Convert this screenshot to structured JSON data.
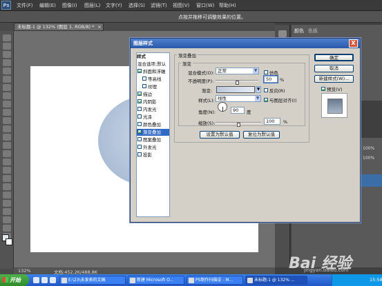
{
  "app": {
    "logo": "Ps"
  },
  "menu": [
    "文件(F)",
    "编辑(E)",
    "图像(I)",
    "图层(L)",
    "文字(Y)",
    "选择(S)",
    "滤镜(T)",
    "视图(V)",
    "窗口(W)",
    "帮助(H)"
  ],
  "options_bar": {
    "hint": "点按并拖移可调整效果的位置。"
  },
  "document": {
    "tab_title": "未标题-1 @ 132% (图层 1, RGB/8) *",
    "close": "×",
    "zoom": "132%",
    "doc_info": "文档:452.2K/488.8K"
  },
  "panels": {
    "color_tab": "颜色",
    "swatches_tab": "色板",
    "percent_a": "100%",
    "percent_b": "100%"
  },
  "dialog": {
    "title": "图层样式",
    "close": "X",
    "styles_header": "样式",
    "style_items": [
      {
        "label": "混合选项:默认",
        "checkbox": false,
        "checked": false,
        "selected": false
      },
      {
        "label": "斜面和浮雕",
        "checkbox": true,
        "checked": true,
        "selected": false
      },
      {
        "label": "等高线",
        "checkbox": true,
        "checked": false,
        "selected": false
      },
      {
        "label": "纹理",
        "checkbox": true,
        "checked": false,
        "selected": false
      },
      {
        "label": "描边",
        "checkbox": true,
        "checked": true,
        "selected": false
      },
      {
        "label": "内阴影",
        "checkbox": true,
        "checked": true,
        "selected": false
      },
      {
        "label": "内发光",
        "checkbox": true,
        "checked": false,
        "selected": false
      },
      {
        "label": "光泽",
        "checkbox": true,
        "checked": false,
        "selected": false
      },
      {
        "label": "颜色叠加",
        "checkbox": true,
        "checked": false,
        "selected": false
      },
      {
        "label": "渐变叠加",
        "checkbox": true,
        "checked": true,
        "selected": true
      },
      {
        "label": "图案叠加",
        "checkbox": true,
        "checked": false,
        "selected": false
      },
      {
        "label": "外发光",
        "checkbox": true,
        "checked": false,
        "selected": false
      },
      {
        "label": "投影",
        "checkbox": true,
        "checked": false,
        "selected": false
      }
    ],
    "section_title": "渐变叠加",
    "group_title": "渐变",
    "blend_mode_label": "混合模式(O):",
    "blend_mode_value": "正常",
    "dither_label": "仿色",
    "dither_checked": false,
    "opacity_label": "不透明度(P):",
    "opacity_value": "50",
    "opacity_unit": "%",
    "opacity_level": 0.5,
    "gradient_label": "渐变:",
    "reverse_label": "反向(R)",
    "reverse_checked": false,
    "style_label": "样式(L):",
    "style_value": "线性",
    "align_label": "与图层对齐(I)",
    "align_checked": true,
    "angle_label": "角度(N):",
    "angle_value": "90",
    "angle_unit": "度",
    "scale_label": "缩放(S):",
    "scale_value": "100",
    "scale_unit": "%",
    "scale_level": 0.5,
    "set_default_btn": "设置为默认值",
    "reset_default_btn": "复位为默认值",
    "ok_btn": "确定",
    "cancel_btn": "取消",
    "new_style_btn": "新建样式(W)...",
    "preview_label": "预览(V)",
    "preview_checked": true
  },
  "taskbar": {
    "start_label": "开始",
    "tasks": [
      {
        "label": "E:\\23\\未发表的文稿",
        "active": false
      },
      {
        "label": "新建 Microsoft O...",
        "active": false
      },
      {
        "label": "PS制作扫描设 - M...",
        "active": false
      },
      {
        "label": "未标题-1 @ 132% ...",
        "active": true
      }
    ],
    "clock": "15:58"
  },
  "watermark": {
    "text": "Bai 经验",
    "url": "jingyan.baidu.com"
  }
}
